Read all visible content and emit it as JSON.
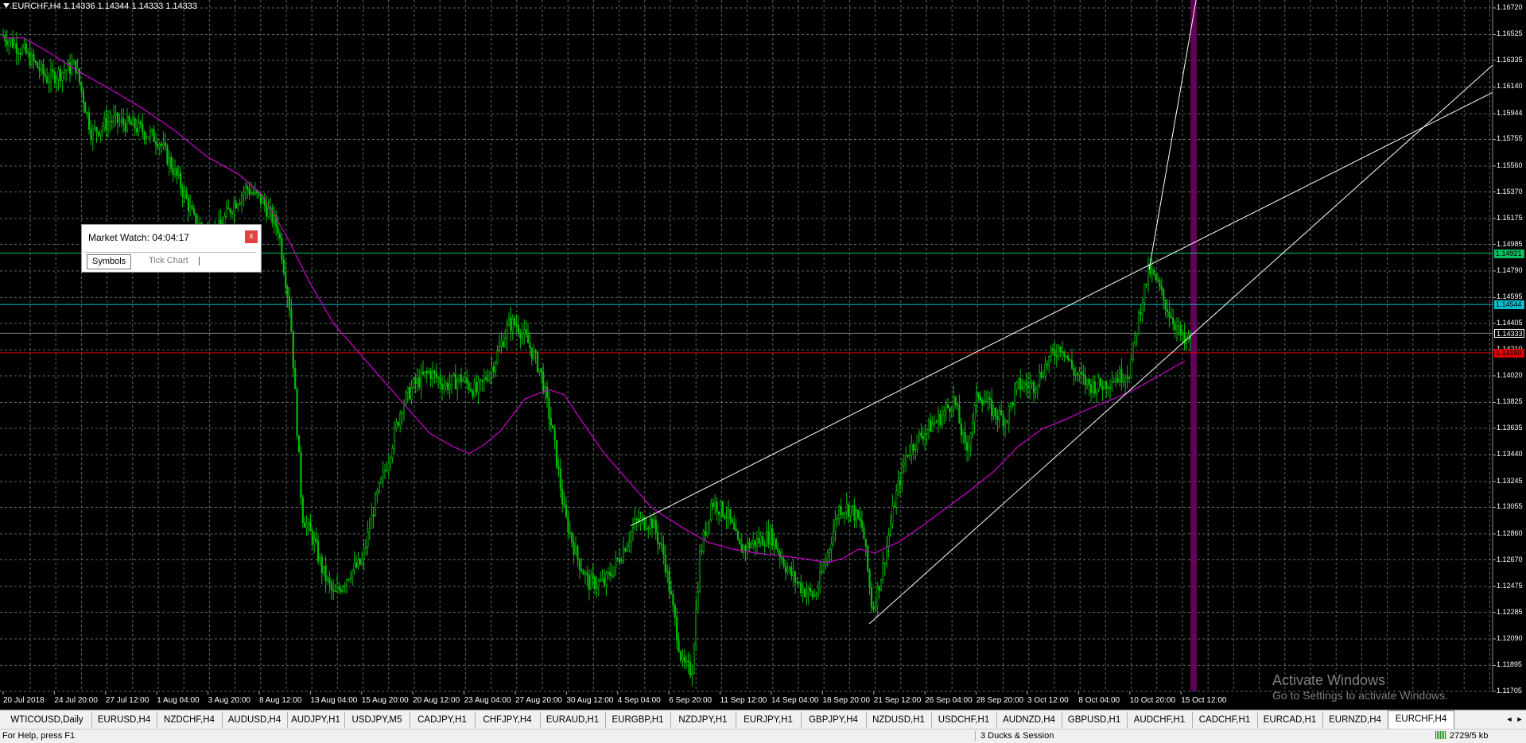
{
  "chart": {
    "symbol_info": "EURCHF,H4  1.14336 1.14344 1.14333 1.14333",
    "colors": {
      "background": "#000000",
      "grid": "#5a6a6a",
      "candles": "#00c000",
      "moving_average": "#c000c0",
      "trendline": "#ffffff",
      "hline_green": "#00c060",
      "hline_cyan": "#00c0d0",
      "hline_red": "#e00000",
      "hline_gray": "#808080",
      "vline_session": "#7a0060"
    },
    "price_axis": [
      "1.16720",
      "1.16525",
      "1.16335",
      "1.16140",
      "1.15944",
      "1.15755",
      "1.15560",
      "1.15370",
      "1.15175",
      "1.14985",
      "1.14790",
      "1.14595",
      "1.14405",
      "1.14210",
      "1.14020",
      "1.13825",
      "1.13635",
      "1.13440",
      "1.13245",
      "1.13055",
      "1.12860",
      "1.12670",
      "1.12475",
      "1.12285",
      "1.12090",
      "1.11895",
      "1.11705"
    ],
    "price_tags": [
      {
        "value": "1.14921",
        "color": "#00c060",
        "text_color": "#000000"
      },
      {
        "value": "1.14544",
        "color": "#00c0d0",
        "text_color": "#000000"
      },
      {
        "value": "1.14333",
        "color": "#000000",
        "text_color": "#ffffff"
      },
      {
        "value": "1.14190",
        "color": "#e00000",
        "text_color": "#000000"
      }
    ],
    "time_axis": [
      "20 Jul 2018",
      "24 Jul 20:00",
      "27 Jul 12:00",
      "1 Aug 04:00",
      "3 Aug 20:00",
      "8 Aug 12:00",
      "13 Aug 04:00",
      "15 Aug 20:00",
      "20 Aug 12:00",
      "23 Aug 04:00",
      "27 Aug 20:00",
      "30 Aug 12:00",
      "4 Sep 04:00",
      "6 Sep 20:00",
      "11 Sep 12:00",
      "14 Sep 04:00",
      "18 Sep 20:00",
      "21 Sep 12:00",
      "26 Sep 04:00",
      "28 Sep 20:00",
      "3 Oct 12:00",
      "8 Oct 04:00",
      "10 Oct 20:00",
      "15 Oct 12:00"
    ],
    "watermark_line1": "Activate Windows",
    "watermark_line2": "Go to Settings to activate Windows."
  },
  "market_watch": {
    "title": "Market Watch: 04:04:17",
    "close_label": "x",
    "tabs": [
      "Symbols",
      "Tick Chart"
    ]
  },
  "chart_tabs": [
    "WTICOUSD,Daily",
    "EURUSD,H4",
    "NZDCHF,H4",
    "AUDUSD,H4",
    "AUDJPY,H1",
    "USDJPY,M5",
    "CADJPY,H1",
    "CHFJPY,H4",
    "EURAUD,H1",
    "EURGBP,H1",
    "NZDJPY,H1",
    "EURJPY,H1",
    "GBPJPY,H4",
    "NZDUSD,H1",
    "USDCHF,H1",
    "AUDNZD,H4",
    "GBPUSD,H1",
    "AUDCHF,H1",
    "CADCHF,H1",
    "EURCAD,H1",
    "EURNZD,H4",
    "EURCHF,H4"
  ],
  "active_tab": "EURCHF,H4",
  "tab_scroll": {
    "left": "◄",
    "right": "►"
  },
  "status": {
    "help": "For Help, press F1",
    "profile": "3 Ducks & Session",
    "connection": "2729/5 kb"
  }
}
